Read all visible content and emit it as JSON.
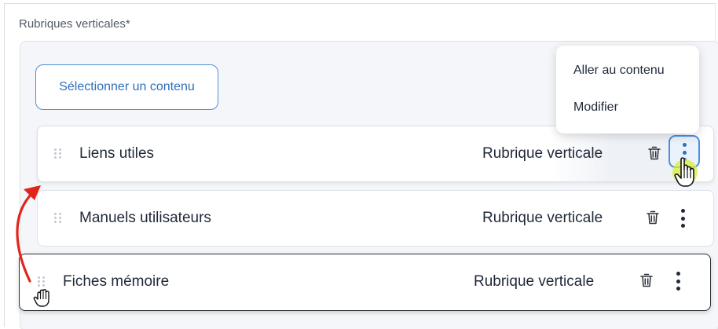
{
  "field": {
    "label": "Rubriques verticales*"
  },
  "select_button": {
    "label": "Sélectionner un contenu"
  },
  "rows": [
    {
      "title": "Liens utiles",
      "type": "Rubrique verticale"
    },
    {
      "title": "Manuels utilisateurs",
      "type": "Rubrique verticale"
    },
    {
      "title": "Fiches mémoire",
      "type": "Rubrique verticale"
    }
  ],
  "context_menu": {
    "items": [
      "Aller au contenu",
      "Modifier"
    ]
  },
  "icons": {
    "drag_handle": "drag-handle-icon",
    "delete": "trash-icon",
    "more": "more-vertical-icon",
    "pointer": "hand-pointer-icon",
    "grab": "hand-grab-icon",
    "annotation": "curved-arrow-icon"
  },
  "colors": {
    "accent": "#2f6fbd",
    "accent_border": "#4a8ee0",
    "annotation_arrow": "#e0261b",
    "cursor_highlight": "#d6f03a"
  }
}
